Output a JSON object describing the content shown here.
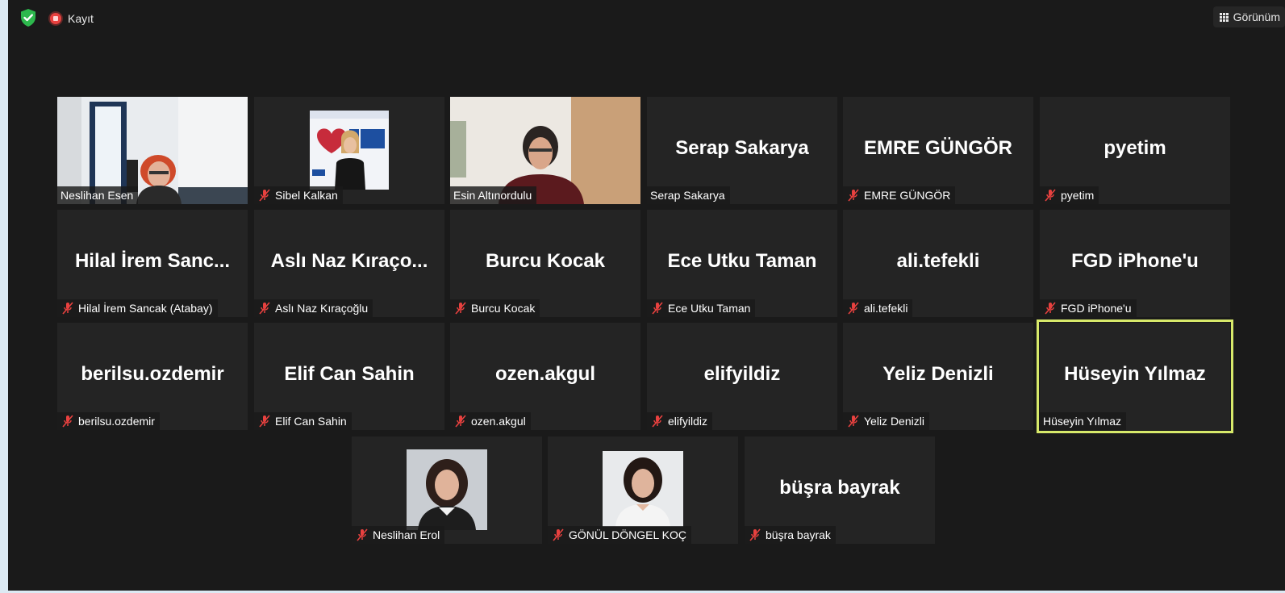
{
  "topbar": {
    "recording_label": "Kayıt",
    "view_label": "Görünüm"
  },
  "tiles": [
    {
      "name": "Neslihan Esen",
      "muted": false,
      "video": true
    },
    {
      "name": "Sibel Kalkan",
      "muted": true,
      "video": true
    },
    {
      "name": "Esin Altınordulu",
      "muted": false,
      "video": true
    },
    {
      "name": "Serap Sakarya",
      "display": "Serap Sakarya",
      "muted": false,
      "video": false
    },
    {
      "name": "EMRE GÜNGÖR",
      "display": "EMRE GÜNGÖR",
      "muted": true,
      "video": false
    },
    {
      "name": "pyetim",
      "display": "pyetim",
      "muted": true,
      "video": false
    },
    {
      "name": "Hilal İrem Sancak (Atabay)",
      "display": "Hilal İrem Sanc...",
      "muted": true,
      "video": false
    },
    {
      "name": "Aslı Naz Kıraçoğlu",
      "display": "Aslı Naz Kıraço...",
      "muted": true,
      "video": false
    },
    {
      "name": "Burcu Kocak",
      "display": "Burcu Kocak",
      "muted": true,
      "video": false
    },
    {
      "name": "Ece Utku Taman",
      "display": "Ece Utku Taman",
      "muted": true,
      "video": false
    },
    {
      "name": "ali.tefekli",
      "display": "ali.tefekli",
      "muted": true,
      "video": false
    },
    {
      "name": "FGD iPhone'u",
      "display": "FGD iPhone'u",
      "muted": true,
      "video": false
    },
    {
      "name": "berilsu.ozdemir",
      "display": "berilsu.ozdemir",
      "muted": true,
      "video": false
    },
    {
      "name": "Elif Can Sahin",
      "display": "Elif Can Sahin",
      "muted": true,
      "video": false
    },
    {
      "name": "ozen.akgul",
      "display": "ozen.akgul",
      "muted": true,
      "video": false
    },
    {
      "name": "elifyildiz",
      "display": "elifyildiz",
      "muted": true,
      "video": false
    },
    {
      "name": "Yeliz Denizli",
      "display": "Yeliz Denizli",
      "muted": true,
      "video": false
    },
    {
      "name": "Hüseyin Yılmaz",
      "display": "Hüseyin Yılmaz",
      "muted": false,
      "video": false,
      "active_speaker": true
    },
    {
      "name": "Neslihan Erol",
      "muted": true,
      "video": false,
      "photo": true
    },
    {
      "name": "GÖNÜL DÖNGEL KOÇ",
      "muted": true,
      "video": false,
      "photo": true
    },
    {
      "name": "büşra bayrak",
      "display": "büşra bayrak",
      "muted": true,
      "video": false
    }
  ],
  "colors": {
    "background": "#1a1a1a",
    "tile": "#242424",
    "active_speaker_border": "#d7e96a",
    "mute_icon": "#e8413f"
  }
}
